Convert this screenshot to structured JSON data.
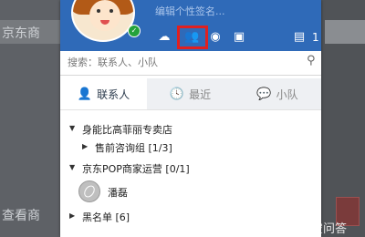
{
  "background": {
    "left_text_top": "京东商",
    "left_text_bottom": "查看商",
    "watermark": "悟空问答"
  },
  "header": {
    "nickname": "编辑个性签名...",
    "message_count": "1",
    "icons": [
      "cloud-icon",
      "group-icon",
      "contacts-icon",
      "bag-icon",
      "chat-icon"
    ]
  },
  "search": {
    "placeholder": "搜索：联系人、小队"
  },
  "tabs": [
    {
      "label": "联系人",
      "icon": "person-icon",
      "active": true
    },
    {
      "label": "最近",
      "icon": "clock-icon",
      "active": false
    },
    {
      "label": "小队",
      "icon": "team-chat-icon",
      "active": false
    }
  ],
  "tree": {
    "group1": {
      "label": "身能比高菲丽专卖店"
    },
    "subgroup1": {
      "label": "售前咨询组 [1/3]"
    },
    "group2": {
      "label": "京东POP商家运营 [0/1]"
    },
    "contact1": {
      "label": "潘磊"
    },
    "group3": {
      "label": "黑名单 [6]"
    }
  },
  "colors": {
    "header_bg": "#2f6ab8",
    "highlight": "#e02020",
    "status_online": "#23a23a"
  }
}
